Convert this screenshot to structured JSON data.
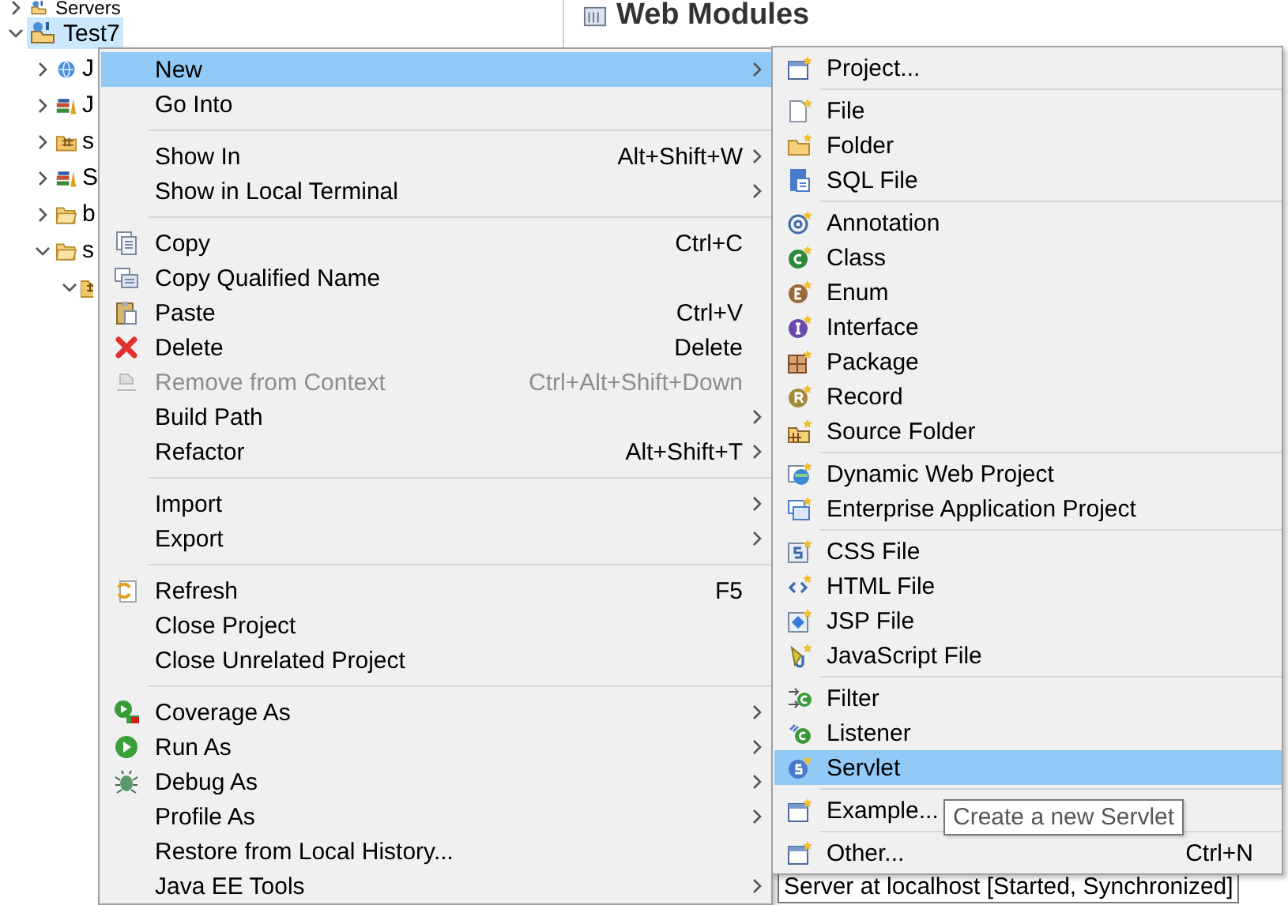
{
  "project_explorer": {
    "items": [
      {
        "label": "Servers",
        "expanded": false,
        "selected": false
      },
      {
        "label": "Test7",
        "expanded": true,
        "selected": true,
        "children": [
          {
            "label": "J",
            "expanded": false,
            "selected": false
          },
          {
            "label": "J",
            "expanded": false,
            "selected": false
          },
          {
            "label": "s",
            "expanded": false,
            "selected": false
          },
          {
            "label": "S",
            "expanded": false,
            "selected": false
          },
          {
            "label": "b",
            "expanded": false,
            "selected": false
          },
          {
            "label": "s",
            "expanded": true,
            "selected": false,
            "children": [
              {
                "expanded": true,
                "selected": false
              }
            ]
          }
        ]
      }
    ]
  },
  "editor": {
    "title": "Web Modules",
    "server_row": "Server at localhost  [Started, Synchronized]"
  },
  "context_menu": {
    "items": [
      {
        "kind": "item",
        "label": "New",
        "selected": true,
        "disabled": false,
        "submenu": true
      },
      {
        "kind": "item",
        "label": "Go Into",
        "selected": false,
        "disabled": false,
        "submenu": false
      },
      {
        "kind": "separator"
      },
      {
        "kind": "item",
        "label": "Show In",
        "shortcut": "Alt+Shift+W",
        "selected": false,
        "disabled": false,
        "submenu": true
      },
      {
        "kind": "item",
        "label": "Show in Local Terminal",
        "selected": false,
        "disabled": false,
        "submenu": true
      },
      {
        "kind": "separator"
      },
      {
        "kind": "item",
        "label": "Copy",
        "shortcut": "Ctrl+C",
        "selected": false,
        "disabled": false,
        "submenu": false
      },
      {
        "kind": "item",
        "label": "Copy Qualified Name",
        "selected": false,
        "disabled": false,
        "submenu": false
      },
      {
        "kind": "item",
        "label": "Paste",
        "shortcut": "Ctrl+V",
        "selected": false,
        "disabled": false,
        "submenu": false
      },
      {
        "kind": "item",
        "label": "Delete",
        "shortcut": "Delete",
        "selected": false,
        "disabled": false,
        "submenu": false
      },
      {
        "kind": "item",
        "label": "Remove from Context",
        "shortcut": "Ctrl+Alt+Shift+Down",
        "selected": false,
        "disabled": true,
        "submenu": false
      },
      {
        "kind": "item",
        "label": "Build Path",
        "selected": false,
        "disabled": false,
        "submenu": true
      },
      {
        "kind": "item",
        "label": "Refactor",
        "shortcut": "Alt+Shift+T",
        "selected": false,
        "disabled": false,
        "submenu": true
      },
      {
        "kind": "separator"
      },
      {
        "kind": "item",
        "label": "Import",
        "selected": false,
        "disabled": false,
        "submenu": true
      },
      {
        "kind": "item",
        "label": "Export",
        "selected": false,
        "disabled": false,
        "submenu": true
      },
      {
        "kind": "separator"
      },
      {
        "kind": "item",
        "label": "Refresh",
        "shortcut": "F5",
        "selected": false,
        "disabled": false,
        "submenu": false
      },
      {
        "kind": "item",
        "label": "Close Project",
        "selected": false,
        "disabled": false,
        "submenu": false
      },
      {
        "kind": "item",
        "label": "Close Unrelated Project",
        "selected": false,
        "disabled": false,
        "submenu": false
      },
      {
        "kind": "separator"
      },
      {
        "kind": "item",
        "label": "Coverage As",
        "selected": false,
        "disabled": false,
        "submenu": true
      },
      {
        "kind": "item",
        "label": "Run As",
        "selected": false,
        "disabled": false,
        "submenu": true
      },
      {
        "kind": "item",
        "label": "Debug As",
        "selected": false,
        "disabled": false,
        "submenu": true
      },
      {
        "kind": "item",
        "label": "Profile As",
        "selected": false,
        "disabled": false,
        "submenu": true
      },
      {
        "kind": "item",
        "label": "Restore from Local History...",
        "selected": false,
        "disabled": false,
        "submenu": false
      },
      {
        "kind": "item",
        "label": "Java EE Tools",
        "selected": false,
        "disabled": false,
        "submenu": true
      }
    ]
  },
  "new_submenu": {
    "items": [
      {
        "kind": "item",
        "label": "Project...",
        "selected": false,
        "disabled": false,
        "submenu": false
      },
      {
        "kind": "separator"
      },
      {
        "kind": "item",
        "label": "File",
        "selected": false,
        "disabled": false,
        "submenu": false
      },
      {
        "kind": "item",
        "label": "Folder",
        "selected": false,
        "disabled": false,
        "submenu": false
      },
      {
        "kind": "item",
        "label": "SQL File",
        "selected": false,
        "disabled": false,
        "submenu": false
      },
      {
        "kind": "separator"
      },
      {
        "kind": "item",
        "label": "Annotation",
        "selected": false,
        "disabled": false,
        "submenu": false
      },
      {
        "kind": "item",
        "label": "Class",
        "selected": false,
        "disabled": false,
        "submenu": false
      },
      {
        "kind": "item",
        "label": "Enum",
        "selected": false,
        "disabled": false,
        "submenu": false
      },
      {
        "kind": "item",
        "label": "Interface",
        "selected": false,
        "disabled": false,
        "submenu": false
      },
      {
        "kind": "item",
        "label": "Package",
        "selected": false,
        "disabled": false,
        "submenu": false
      },
      {
        "kind": "item",
        "label": "Record",
        "selected": false,
        "disabled": false,
        "submenu": false
      },
      {
        "kind": "item",
        "label": "Source Folder",
        "selected": false,
        "disabled": false,
        "submenu": false
      },
      {
        "kind": "separator"
      },
      {
        "kind": "item",
        "label": "Dynamic Web Project",
        "selected": false,
        "disabled": false,
        "submenu": false
      },
      {
        "kind": "item",
        "label": "Enterprise Application Project",
        "selected": false,
        "disabled": false,
        "submenu": false
      },
      {
        "kind": "separator"
      },
      {
        "kind": "item",
        "label": "CSS File",
        "selected": false,
        "disabled": false,
        "submenu": false
      },
      {
        "kind": "item",
        "label": "HTML File",
        "selected": false,
        "disabled": false,
        "submenu": false
      },
      {
        "kind": "item",
        "label": "JSP File",
        "selected": false,
        "disabled": false,
        "submenu": false
      },
      {
        "kind": "item",
        "label": "JavaScript File",
        "selected": false,
        "disabled": false,
        "submenu": false
      },
      {
        "kind": "separator"
      },
      {
        "kind": "item",
        "label": "Filter",
        "selected": false,
        "disabled": false,
        "submenu": false
      },
      {
        "kind": "item",
        "label": "Listener",
        "selected": false,
        "disabled": false,
        "submenu": false
      },
      {
        "kind": "item",
        "label": "Servlet",
        "selected": true,
        "disabled": false,
        "submenu": false
      },
      {
        "kind": "separator"
      },
      {
        "kind": "item",
        "label": "Example...",
        "selected": false,
        "disabled": false,
        "submenu": false
      },
      {
        "kind": "separator"
      },
      {
        "kind": "item",
        "label": "Other...",
        "shortcut": "Ctrl+N",
        "selected": false,
        "disabled": false,
        "submenu": false
      }
    ]
  },
  "tooltip": {
    "text": "Create a new Servlet"
  }
}
